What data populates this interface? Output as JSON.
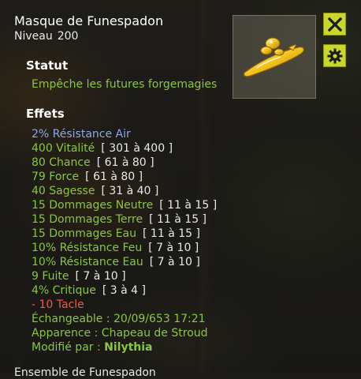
{
  "item": {
    "name": "Masque de Funespadon",
    "level_label": "Niveau",
    "level_value": "200"
  },
  "buttons": {
    "close_icon": "close-icon",
    "settings_icon": "gear-icon"
  },
  "statut": {
    "heading": "Statut",
    "text": "Empêche les futures forgemagies"
  },
  "effets": {
    "heading": "Effets",
    "lines": [
      {
        "text": "2% Résistance Air",
        "range": "",
        "color": "#8fa6ea"
      },
      {
        "text": "400 Vitalité",
        "range": "[ 301 à 400 ]",
        "color": "#8cc63f"
      },
      {
        "text": "80 Chance",
        "range": "[ 61 à 80 ]",
        "color": "#8cc63f"
      },
      {
        "text": "79 Force",
        "range": "[ 61 à 80 ]",
        "color": "#8cc63f"
      },
      {
        "text": "40 Sagesse",
        "range": "[ 31 à 40 ]",
        "color": "#8cc63f"
      },
      {
        "text": "15 Dommages Neutre",
        "range": "[ 11 à 15 ]",
        "color": "#8cc63f"
      },
      {
        "text": "15 Dommages Terre",
        "range": "[ 11 à 15 ]",
        "color": "#8cc63f"
      },
      {
        "text": "15 Dommages Eau",
        "range": "[ 11 à 15 ]",
        "color": "#8cc63f"
      },
      {
        "text": "10% Résistance Feu",
        "range": "[ 7 à 10 ]",
        "color": "#8cc63f"
      },
      {
        "text": "10% Résistance Eau",
        "range": "[ 7 à 10 ]",
        "color": "#8cc63f"
      },
      {
        "text": "9 Fuite",
        "range": "[ 7 à 10 ]",
        "color": "#8cc63f"
      },
      {
        "text": "4% Critique",
        "range": "[ 3 à 4 ]",
        "color": "#8cc63f"
      },
      {
        "text": "- 10 Tacle",
        "range": "",
        "color": "#ef5a4e"
      },
      {
        "text": "Échangeable : 20/09/653 17:21",
        "range": "",
        "color": "#8cc63f"
      },
      {
        "text": "Apparence : Chapeau de Stroud",
        "range": "",
        "color": "#8cc63f"
      },
      {
        "text": "Modifié par : ",
        "range": "",
        "color": "#8cc63f",
        "bold_suffix": "Nilythia"
      }
    ]
  },
  "footer_peek": "Ensemble de Funespadon"
}
